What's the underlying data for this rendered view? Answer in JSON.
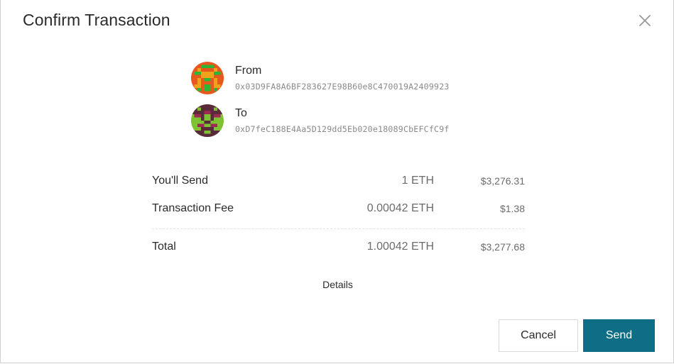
{
  "dialog": {
    "title": "Confirm Transaction"
  },
  "from": {
    "label": "From",
    "address": "0x03D9FA8A6BF283627E98B60e8C470019A2409923"
  },
  "to": {
    "label": "To",
    "address": "0xD7feC188E4Aa5D129dd5Eb020e18089CbEFCfC9f"
  },
  "summary": {
    "send": {
      "label": "You'll Send",
      "amount": "1 ETH",
      "usd": "$3,276.31"
    },
    "fee": {
      "label": "Transaction Fee",
      "amount": "0.00042 ETH",
      "usd": "$1.38"
    },
    "total": {
      "label": "Total",
      "amount": "1.00042 ETH",
      "usd": "$3,277.68"
    }
  },
  "details_label": "Details",
  "buttons": {
    "cancel": "Cancel",
    "send": "Send"
  },
  "colors": {
    "primary": "#0e6e86",
    "from_avatar": [
      "#e8571e",
      "#f0a21a",
      "#2fb535"
    ],
    "to_avatar": [
      "#5a2a3a",
      "#9c2a52",
      "#7ec234"
    ]
  }
}
